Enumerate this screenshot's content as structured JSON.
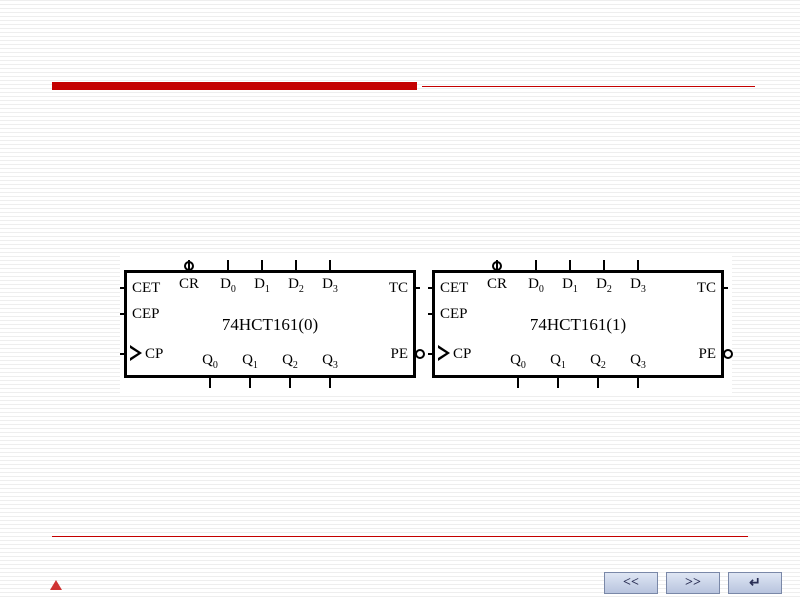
{
  "colors": {
    "accent": "#c40000",
    "nav_bg": "#c9d3e8",
    "ink": "#000000"
  },
  "chips": [
    {
      "part_name": "74HCT161(0)",
      "left_pins": {
        "cet": "CET",
        "cep": "CEP",
        "cp": "CP"
      },
      "right_pins": {
        "tc": "TC",
        "pe": "PE"
      },
      "top_labels": [
        "CR",
        "D0",
        "D1",
        "D2",
        "D3"
      ],
      "bot_labels": [
        "Q0",
        "Q1",
        "Q2",
        "Q3"
      ],
      "cr_inverted": true,
      "pe_inverted": true
    },
    {
      "part_name": "74HCT161(1)",
      "left_pins": {
        "cet": "CET",
        "cep": "CEP",
        "cp": "CP"
      },
      "right_pins": {
        "tc": "TC",
        "pe": "PE"
      },
      "top_labels": [
        "CR",
        "D0",
        "D1",
        "D2",
        "D3"
      ],
      "bot_labels": [
        "Q0",
        "Q1",
        "Q2",
        "Q3"
      ],
      "cr_inverted": true,
      "pe_inverted": true
    }
  ],
  "nav": {
    "prev_label": "<<",
    "next_label": ">>",
    "enter_label": "↵"
  },
  "chart_data": {
    "type": "table",
    "description": "Block diagram of two cascaded 74HCT161 4-bit synchronous binary counters",
    "blocks": [
      {
        "id": "74HCT161(0)",
        "inputs_left": [
          "CET",
          "CEP",
          "CP"
        ],
        "inputs_top": [
          "CR",
          "D0",
          "D1",
          "D2",
          "D3"
        ],
        "outputs_right": [
          "TC",
          "PE"
        ],
        "outputs_bottom": [
          "Q0",
          "Q1",
          "Q2",
          "Q3"
        ],
        "inverted_pins": [
          "CR",
          "PE"
        ]
      },
      {
        "id": "74HCT161(1)",
        "inputs_left": [
          "CET",
          "CEP",
          "CP"
        ],
        "inputs_top": [
          "CR",
          "D0",
          "D1",
          "D2",
          "D3"
        ],
        "outputs_right": [
          "TC",
          "PE"
        ],
        "outputs_bottom": [
          "Q0",
          "Q1",
          "Q2",
          "Q3"
        ],
        "inverted_pins": [
          "CR",
          "PE"
        ]
      }
    ]
  }
}
